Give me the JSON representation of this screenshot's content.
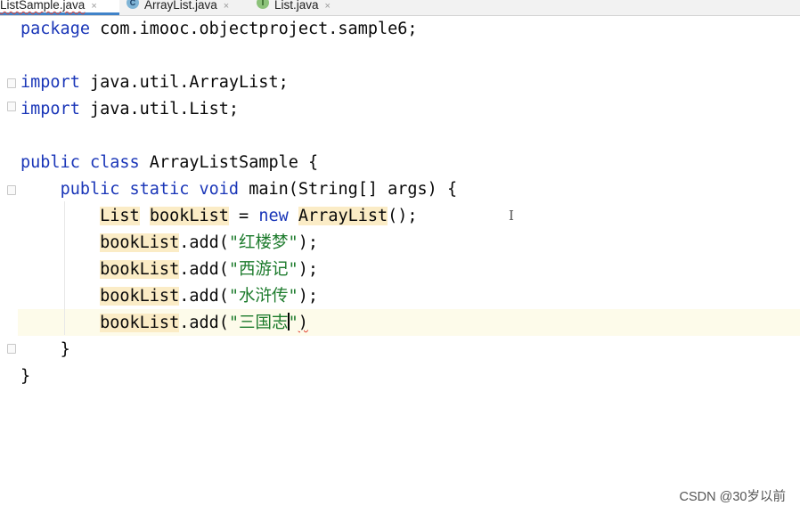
{
  "tabs": [
    {
      "label": "ListSample.java",
      "close": "×",
      "active": true
    },
    {
      "label": "ArrayList.java",
      "close": "×",
      "icon": "class-icon",
      "icon_letter": "C"
    },
    {
      "label": "List.java",
      "close": "×",
      "icon": "interface-icon",
      "icon_letter": "I"
    }
  ],
  "code": {
    "line1": {
      "kw": "package",
      "rest": " com.imooc.objectproject.sample6;"
    },
    "line3": {
      "kw": "import",
      "rest": " java.util.ArrayList;"
    },
    "line4": {
      "kw": "import",
      "rest": " java.util.List;"
    },
    "line6": {
      "kw1": "public",
      "kw2": "class",
      "rest": " ArrayListSample {"
    },
    "line7": {
      "kw1": "public",
      "kw2": "static",
      "kw3": "void",
      "rest": " main(String[] args) {"
    },
    "line8": {
      "type": "List",
      "var": "bookList",
      "eq": " = ",
      "kw": "new",
      "ctor": "ArrayList",
      "tail": "();"
    },
    "line9": {
      "obj": "bookList",
      "call": ".add(",
      "str": "\"红楼梦\"",
      "tail": ");"
    },
    "line10": {
      "obj": "bookList",
      "call": ".add(",
      "str": "\"西游记\"",
      "tail": ");"
    },
    "line11": {
      "obj": "bookList",
      "call": ".add(",
      "str": "\"水浒传\"",
      "tail": ");"
    },
    "line12": {
      "obj": "bookList",
      "call": ".add(",
      "str_before_caret": "\"三国志",
      "str_after_caret": "\"",
      "tail": ")"
    },
    "line13": {
      "brace": "}"
    },
    "line14": {
      "brace": "}"
    }
  },
  "cursor_glyph": "I",
  "watermark": "CSDN @30岁以前",
  "colors": {
    "keyword": "#1a36b8",
    "string": "#1b7a2b",
    "highlight": "#fbecc6",
    "current_line": "#fdfbea",
    "error": "#e03e2d",
    "tab_underline": "#4083c9"
  }
}
